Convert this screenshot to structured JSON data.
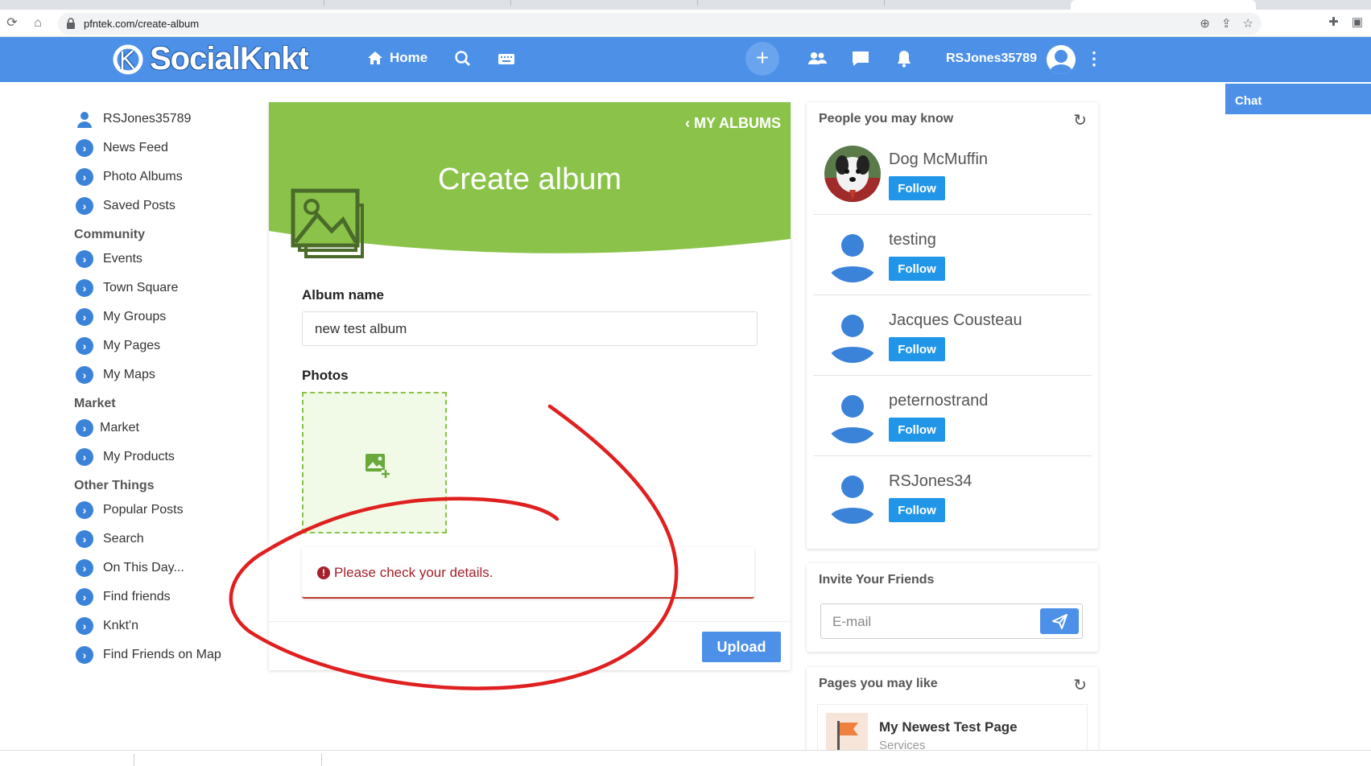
{
  "browser": {
    "url": "pfntek.com/create-album"
  },
  "nav": {
    "brand": "SocialKnkt",
    "home_label": "Home",
    "username": "RSJones35789",
    "chat_label": "Chat"
  },
  "sidebar": {
    "profile": "RSJones35789",
    "top_items": [
      {
        "label": "News Feed"
      },
      {
        "label": "Photo Albums"
      },
      {
        "label": "Saved Posts"
      }
    ],
    "community_heading": "Community",
    "community_items": [
      {
        "label": "Events"
      },
      {
        "label": "Town Square"
      },
      {
        "label": "My Groups"
      },
      {
        "label": "My Pages"
      },
      {
        "label": "My Maps"
      }
    ],
    "market_heading": "Market",
    "market_items": [
      {
        "label": "Market"
      },
      {
        "label": "My Products"
      }
    ],
    "other_heading": "Other Things",
    "other_items": [
      {
        "label": "Popular Posts"
      },
      {
        "label": "Search"
      },
      {
        "label": "On This Day..."
      },
      {
        "label": "Find friends"
      },
      {
        "label": "Knkt'n"
      },
      {
        "label": "Find Friends on Map"
      }
    ]
  },
  "main": {
    "back_link": "MY ALBUMS",
    "title": "Create album",
    "album_name_label": "Album name",
    "album_name_value": "new test album",
    "photos_label": "Photos",
    "error_message": "Please check your details.",
    "upload_label": "Upload",
    "banner_color": "#8bc34a"
  },
  "people": {
    "title": "People you may know",
    "follow_label": "Follow",
    "list": [
      {
        "name": "Dog McMuffin"
      },
      {
        "name": "testing"
      },
      {
        "name": "Jacques Cousteau"
      },
      {
        "name": "peternostrand"
      },
      {
        "name": "RSJones34"
      }
    ]
  },
  "invite": {
    "title": "Invite Your Friends",
    "placeholder": "E-mail"
  },
  "pages": {
    "title": "Pages you may like",
    "item_title": "My Newest Test Page",
    "item_category": "Services"
  },
  "colors": {
    "nav_blue": "#4d90e8",
    "follow_blue": "#2196e8",
    "error_red": "#a5202a",
    "annotation_red": "#e02020"
  }
}
